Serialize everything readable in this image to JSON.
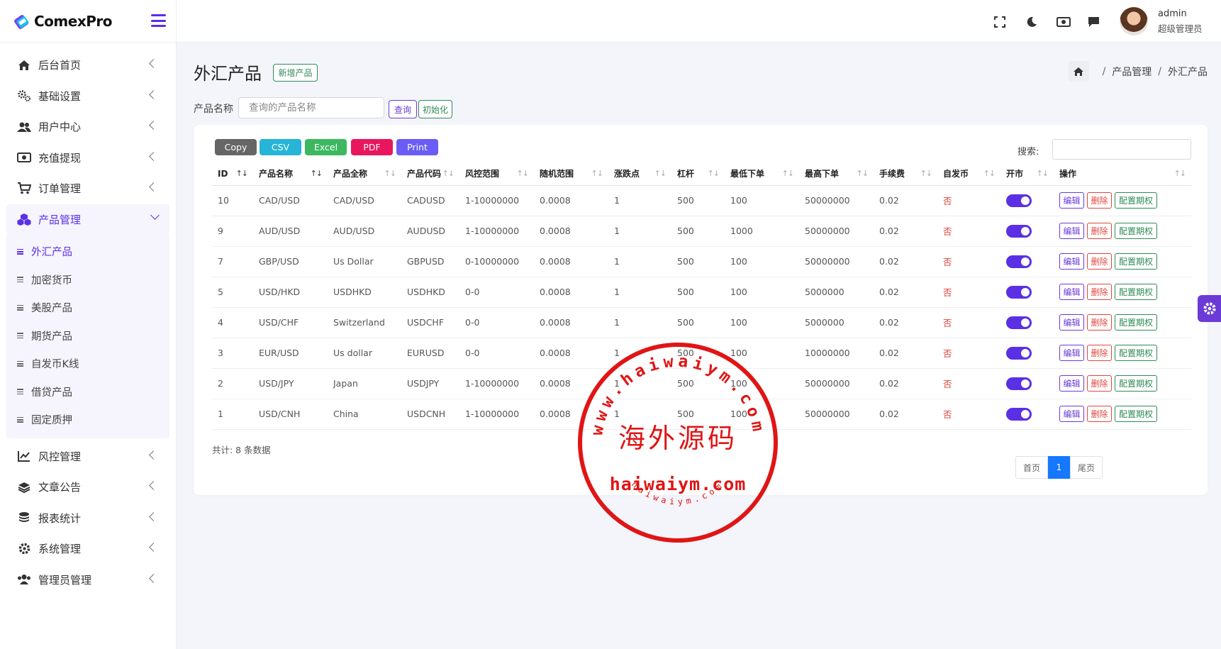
{
  "brand": {
    "name": "ComexPro"
  },
  "sidebar": {
    "items_top": [
      {
        "label": "后台首页",
        "icon": "home-icon"
      },
      {
        "label": "基础设置",
        "icon": "gears-icon"
      },
      {
        "label": "用户中心",
        "icon": "users-icon"
      },
      {
        "label": "充值提现",
        "icon": "money-icon"
      },
      {
        "label": "订单管理",
        "icon": "cart-icon"
      }
    ],
    "active_item": {
      "label": "产品管理",
      "icon": "cubes-icon"
    },
    "sub_items": [
      "外汇产品",
      "加密货币",
      "美股产品",
      "期货产品",
      "自发币K线",
      "借贷产品",
      "固定质押"
    ],
    "active_sub": "外汇产品",
    "items_bottom": [
      {
        "label": "风控管理",
        "icon": "chart-line-icon"
      },
      {
        "label": "文章公告",
        "icon": "layers-icon"
      },
      {
        "label": "报表统计",
        "icon": "coins-icon"
      },
      {
        "label": "系统管理",
        "icon": "gear-icon"
      },
      {
        "label": "管理员管理",
        "icon": "users-cog-icon"
      }
    ]
  },
  "topbar": {
    "user_name": "admin",
    "user_role": "超级管理员"
  },
  "page": {
    "title": "外汇产品",
    "add_button": "新增产品",
    "breadcrumb": [
      "产品管理",
      "外汇产品"
    ]
  },
  "filter": {
    "label": "产品名称",
    "placeholder": "查询的产品名称",
    "query_button": "查询",
    "reset_button": "初始化"
  },
  "toolbar": {
    "buttons": [
      {
        "label": "Copy",
        "color": "#666666"
      },
      {
        "label": "CSV",
        "color": "#26b5d6"
      },
      {
        "label": "Excel",
        "color": "#3db860"
      },
      {
        "label": "PDF",
        "color": "#e8175d"
      },
      {
        "label": "Print",
        "color": "#6a5cf6"
      }
    ],
    "search_label": "搜索:"
  },
  "table": {
    "headers": [
      "ID",
      "产品名称",
      "产品全称",
      "产品代码",
      "风控范围",
      "随机范围",
      "涨跌点",
      "杠杆",
      "最低下单",
      "最高下单",
      "手续费",
      "自发币",
      "开市",
      "操作"
    ],
    "rows": [
      [
        "10",
        "CAD/USD",
        "CAD/USD",
        "CADUSD",
        "1-10000000",
        "0.0008",
        "1",
        "500",
        "100",
        "50000000",
        "0.02",
        "否"
      ],
      [
        "9",
        "AUD/USD",
        "AUD/USD",
        "AUDUSD",
        "1-10000000",
        "0.0008",
        "1",
        "500",
        "1000",
        "50000000",
        "0.02",
        "否"
      ],
      [
        "7",
        "GBP/USD",
        "Us Dollar",
        "GBPUSD",
        "0-10000000",
        "0.0008",
        "1",
        "500",
        "100",
        "50000000",
        "0.02",
        "否"
      ],
      [
        "5",
        "USD/HKD",
        "USDHKD",
        "USDHKD",
        "0-0",
        "0.0008",
        "1",
        "500",
        "100",
        "5000000",
        "0.02",
        "否"
      ],
      [
        "4",
        "USD/CHF",
        "Switzerland",
        "USDCHF",
        "0-0",
        "0.0008",
        "1",
        "500",
        "100",
        "5000000",
        "0.02",
        "否"
      ],
      [
        "3",
        "EUR/USD",
        "Us dollar",
        "EURUSD",
        "0-0",
        "0.0008",
        "1",
        "500",
        "100",
        "10000000",
        "0.02",
        "否"
      ],
      [
        "2",
        "USD/JPY",
        "Japan",
        "USDJPY",
        "1-10000000",
        "0.0008",
        "1",
        "500",
        "100",
        "50000000",
        "0.02",
        "否"
      ],
      [
        "1",
        "USD/CNH",
        "China",
        "USDCNH",
        "1-10000000",
        "0.0008",
        "1",
        "500",
        "100",
        "50000000",
        "0.02",
        "否"
      ]
    ],
    "ops": {
      "edit": "编辑",
      "delete": "删除",
      "config": "配置期权"
    }
  },
  "footer": {
    "total": "共计: 8 条数据"
  },
  "pager": {
    "first": "首页",
    "current": "1",
    "last": "尾页"
  },
  "watermark": {
    "arc_text": "www.haiwaiym.com",
    "center_text": "海外源码",
    "domain_text": "haiwaiym.com",
    "bottom_arc_text": "haiwaiym.com"
  }
}
